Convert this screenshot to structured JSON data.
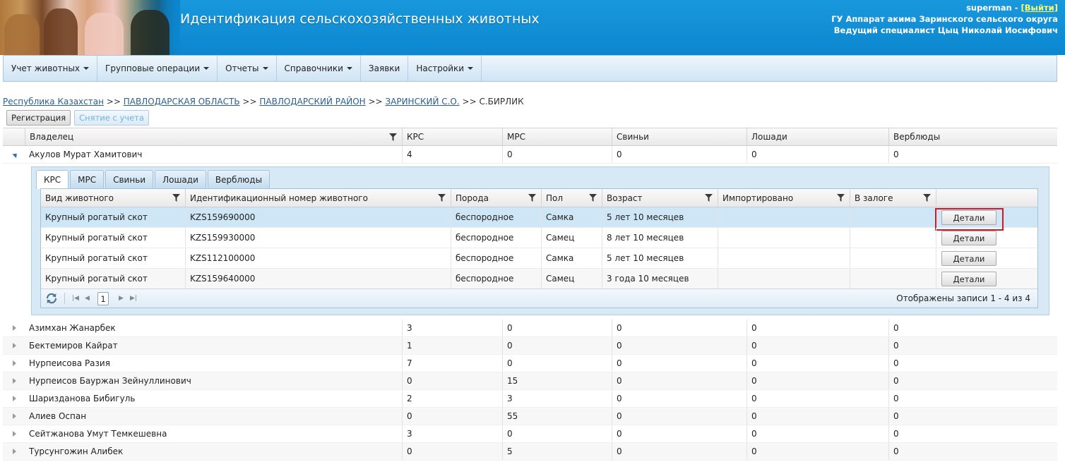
{
  "header": {
    "title": "Идентификация сельскохозяйственных животных",
    "username": "superman",
    "logout_label": "[Выйти]",
    "organization": "ГУ Аппарат акима Заринского сельского округа",
    "position": "Ведущий специалист Цыц Николай Иосифович"
  },
  "menu": {
    "items": [
      {
        "label": "Учет животных",
        "dropdown": true
      },
      {
        "label": "Групповые операции",
        "dropdown": true
      },
      {
        "label": "Отчеты",
        "dropdown": true
      },
      {
        "label": "Справочники",
        "dropdown": true
      },
      {
        "label": "Заявки",
        "dropdown": false
      },
      {
        "label": "Настройки",
        "dropdown": true
      }
    ]
  },
  "breadcrumb": {
    "items": [
      {
        "label": "Республика Казахстан",
        "link": true
      },
      {
        "label": "ПАВЛОДАРСКАЯ ОБЛАСТЬ",
        "link": true
      },
      {
        "label": "ПАВЛОДАРСКИЙ РАЙОН",
        "link": true
      },
      {
        "label": "ЗАРИНСКИЙ С.О.",
        "link": true
      },
      {
        "label": "С.БИРЛИК",
        "link": false
      }
    ],
    "separator": ">>"
  },
  "toolbar": {
    "register_label": "Регистрация",
    "deregister_label": "Снятие с учета"
  },
  "grid": {
    "columns": [
      "Владелец",
      "КРС",
      "МРС",
      "Свиньи",
      "Лошади",
      "Верблюды"
    ],
    "expanded_row": {
      "owner": "Акулов Мурат Хамитович",
      "values": [
        "4",
        "0",
        "0",
        "0",
        "0"
      ]
    },
    "rows": [
      {
        "owner": "Азимхан Жанарбек",
        "values": [
          "3",
          "0",
          "0",
          "0",
          "0"
        ]
      },
      {
        "owner": "Бектемиров Кайрат",
        "values": [
          "1",
          "0",
          "0",
          "0",
          "0"
        ]
      },
      {
        "owner": "Нурпеисова Разия",
        "values": [
          "7",
          "0",
          "0",
          "0",
          "0"
        ]
      },
      {
        "owner": "Нурпеисов Бауржан Зейнуллинович",
        "values": [
          "0",
          "15",
          "0",
          "0",
          "0"
        ]
      },
      {
        "owner": "Шаризданова Бибигуль",
        "values": [
          "2",
          "3",
          "0",
          "0",
          "0"
        ]
      },
      {
        "owner": "Алиев Оспан",
        "values": [
          "0",
          "55",
          "0",
          "0",
          "0"
        ]
      },
      {
        "owner": "Сейтжанова Умут Темкешевна",
        "values": [
          "3",
          "0",
          "0",
          "0",
          "0"
        ]
      },
      {
        "owner": "Турсунгожин Алибек",
        "values": [
          "0",
          "5",
          "0",
          "0",
          "0"
        ]
      }
    ]
  },
  "detail": {
    "tabs": [
      "КРС",
      "МРС",
      "Свиньи",
      "Лошади",
      "Верблюды"
    ],
    "active_tab": "КРС",
    "columns": [
      "Вид животного",
      "Идентификационный номер животного",
      "Порода",
      "Пол",
      "Возраст",
      "Импортировано",
      "В залоге"
    ],
    "details_label": "Детали",
    "rows": [
      {
        "species": "Крупный рогатый скот",
        "id": "KZS159690000",
        "breed": "беспородное",
        "sex": "Самка",
        "age": "5 лет 10 месяцев",
        "imported": "",
        "pledged": ""
      },
      {
        "species": "Крупный рогатый скот",
        "id": "KZS159930000",
        "breed": "беспородное",
        "sex": "Самец",
        "age": "8 лет 10 месяцев",
        "imported": "",
        "pledged": ""
      },
      {
        "species": "Крупный рогатый скот",
        "id": "KZS112100000",
        "breed": "беспородное",
        "sex": "Самка",
        "age": "5 лет 10 месяцев",
        "imported": "",
        "pledged": ""
      },
      {
        "species": "Крупный рогатый скот",
        "id": "KZS159640000",
        "breed": "беспородное",
        "sex": "Самец",
        "age": "3 года 10 месяцев",
        "imported": "",
        "pledged": ""
      }
    ],
    "pager": {
      "current_page": "1",
      "summary": "Отображены записи 1 - 4 из 4"
    }
  },
  "colors": {
    "header_blue": "#0b86cf",
    "selected_row": "#cfe6f6",
    "highlight_box": "#e0141e",
    "link": "#2a5f8f"
  },
  "icons": [
    "filter-icon",
    "refresh-icon",
    "expand-arrow-icon",
    "collapse-arrow-icon",
    "first-page-icon",
    "prev-page-icon",
    "next-page-icon",
    "last-page-icon"
  ]
}
